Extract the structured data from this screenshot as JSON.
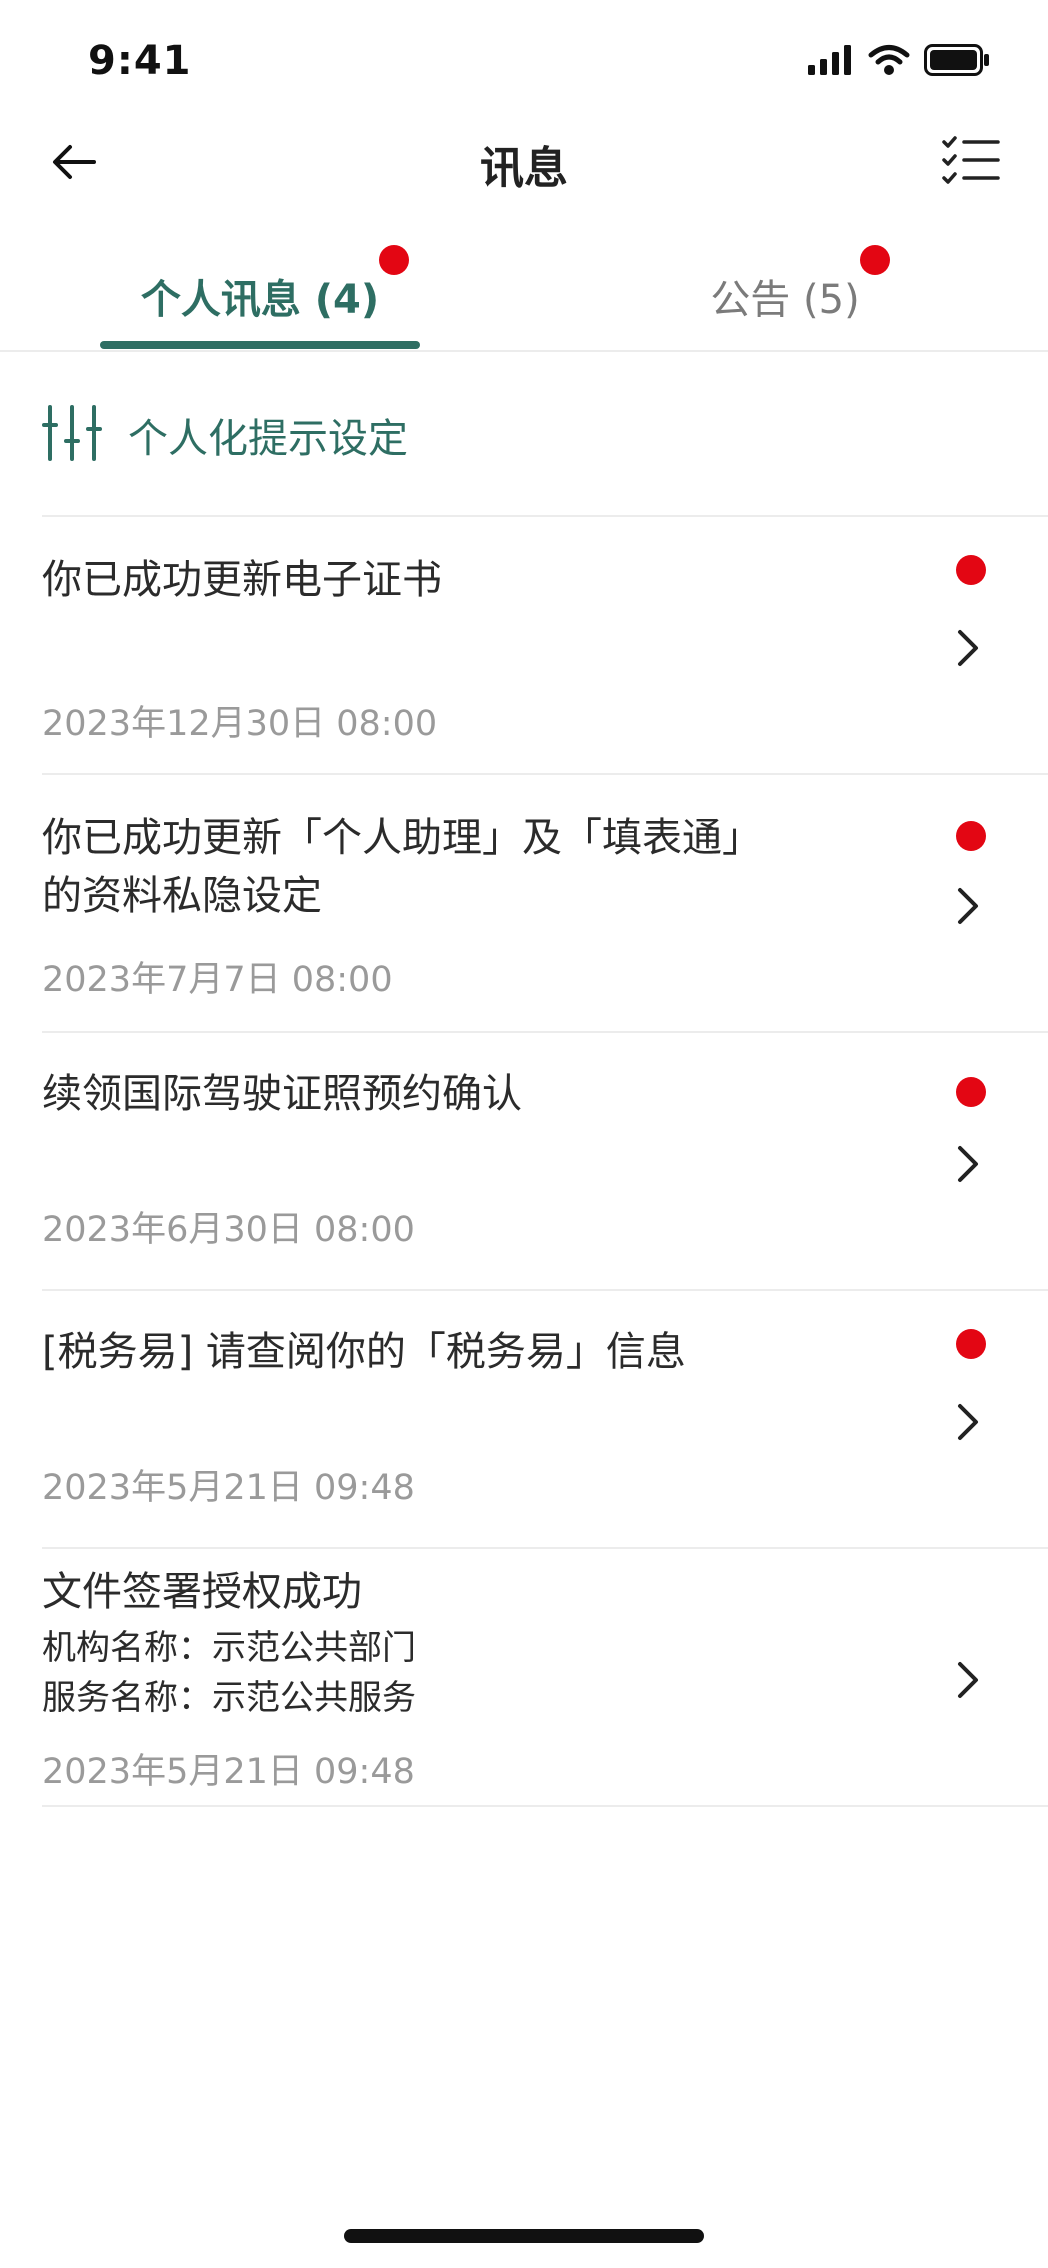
{
  "status_bar": {
    "time": "9:41"
  },
  "header": {
    "title": "讯息"
  },
  "tabs": [
    {
      "label": "个人讯息 (4)",
      "active": true,
      "has_dot": true
    },
    {
      "label": "公告 (5)",
      "active": false,
      "has_dot": true
    }
  ],
  "settings": {
    "label": "个人化提示设定"
  },
  "messages": [
    {
      "title": "你已成功更新电子证书",
      "date": "2023年12月30日 08:00",
      "unread": true
    },
    {
      "title": "你已成功更新「个人助理」及「填表通」的资料私隐设定",
      "date": "2023年7月7日 08:00",
      "unread": true
    },
    {
      "title": "续领国际驾驶证照预约确认",
      "date": "2023年6月30日 08:00",
      "unread": true
    },
    {
      "title": "[税务易] 请查阅你的「税务易」信息",
      "date": "2023年5月21日 09:48",
      "unread": true
    },
    {
      "title": "文件签署授权成功",
      "sub1": "机构名称：示范公共部门",
      "sub2": "服务名称：示范公共服务",
      "date": "2023年5月21日 09:48",
      "unread": false
    }
  ],
  "colors": {
    "accent": "#2e6e63",
    "unread_dot": "#e30613",
    "date_text": "#9a9a9a"
  },
  "icons": {
    "back": "arrow-left-icon",
    "list": "checklist-icon",
    "settings": "sliders-icon",
    "chevron": "chevron-right-icon"
  }
}
